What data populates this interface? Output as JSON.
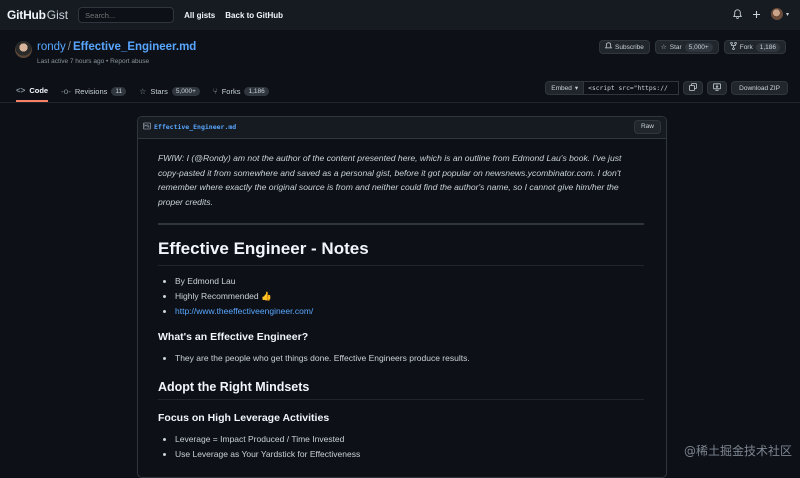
{
  "header": {
    "logo_github": "GitHub",
    "logo_gist": "Gist",
    "search_placeholder": "Search...",
    "links": [
      "All gists",
      "Back to GitHub"
    ]
  },
  "gist": {
    "owner": "rondy",
    "separator": "/",
    "filename": "Effective_Engineer.md",
    "meta": "Last active 7 hours ago • Report abuse",
    "subscribe_label": "Subscribe",
    "star_label": "Star",
    "star_count": "5,000+",
    "fork_label": "Fork",
    "fork_count": "1,186"
  },
  "tabs": [
    {
      "label": "Code",
      "count": ""
    },
    {
      "label": "Revisions",
      "count": "11"
    },
    {
      "label": "Stars",
      "count": "5,000+"
    },
    {
      "label": "Forks",
      "count": "1,186"
    }
  ],
  "embed": {
    "label": "Embed",
    "value": "<script src=\"https://",
    "download_label": "Download ZIP"
  },
  "file": {
    "name": "Effective_Engineer.md",
    "raw_label": "Raw"
  },
  "content": {
    "intro": "FWIW: I (@Rondy) am not the author of the content presented here, which is an outline from Edmond Lau's book. I've just copy-pasted it from somewhere and saved as a personal gist, before it got popular on newsnews.ycombinator.com. I don't remember where exactly the original source is from and neither could find the author's name, so I cannot give him/her the proper credits.",
    "h1": "Effective Engineer - Notes",
    "list1": [
      "By Edmond Lau",
      "Highly Recommended 👍",
      "http://www.theeffectiveengineer.com/"
    ],
    "h3a": "What's an Effective Engineer?",
    "list2": [
      "They are the people who get things done. Effective Engineers produce results."
    ],
    "h2": "Adopt the Right Mindsets",
    "h3b": "Focus on High Leverage Activities",
    "list3": [
      "Leverage = Impact Produced / Time Invested",
      "Use Leverage as Your Yardstick for Effectiveness"
    ]
  },
  "watermark": "@稀土掘金技术社区"
}
